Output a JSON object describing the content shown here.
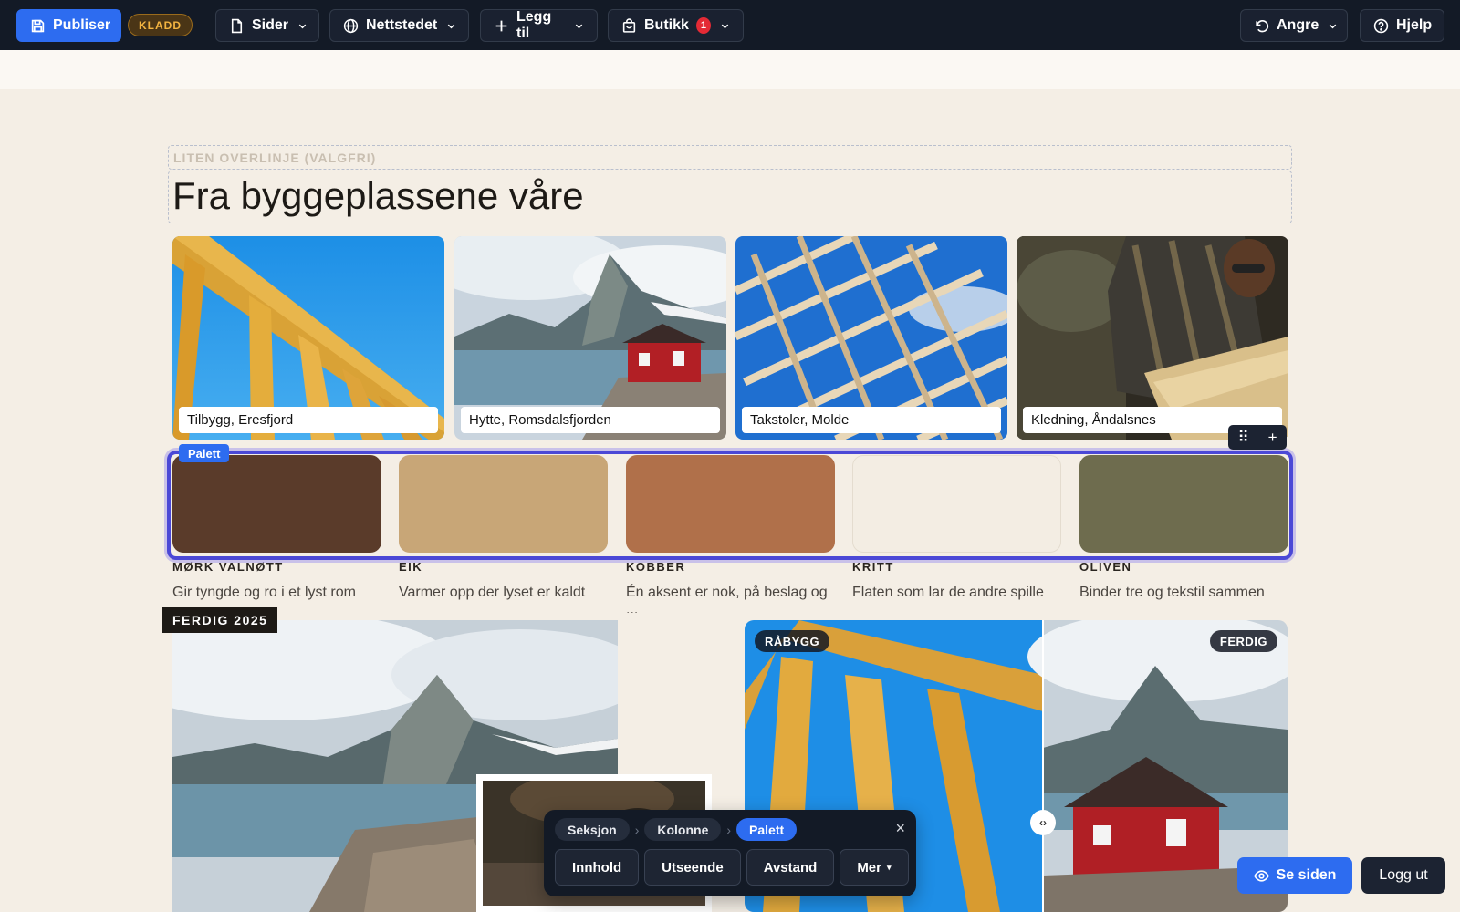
{
  "toolbar": {
    "publish_label": "Publiser",
    "draft_badge": "KLADD",
    "pages_label": "Sider",
    "website_label": "Nettstedet",
    "add_label": "Legg til",
    "shop_label": "Butikk",
    "shop_count": "1",
    "undo_label": "Angre",
    "help_label": "Hjelp"
  },
  "header": {
    "overline_placeholder": "LITEN OVERLINJE (VALGFRI)",
    "title": "Fra byggeplassene våre"
  },
  "photos": [
    {
      "caption": "Tilbygg, Eresfjord"
    },
    {
      "caption": "Hytte, Romsdalsfjorden"
    },
    {
      "caption": "Takstoler, Molde"
    },
    {
      "caption": "Kledning, Åndalsnes"
    }
  ],
  "palette": {
    "tag": "Palett",
    "swatches": [
      {
        "name": "MØRK VALNØTT",
        "desc": "Gir tyngde og ro i et lyst rom",
        "color": "#5a3b2a"
      },
      {
        "name": "EIK",
        "desc": "Varmer opp der lyset er kaldt",
        "color": "#c8a677"
      },
      {
        "name": "KOBBER",
        "desc": "Én aksent er nok, på beslag og ...",
        "color": "#b0704a"
      },
      {
        "name": "KRITT",
        "desc": "Flaten som lar de andre spille",
        "color": "#f3ede3"
      },
      {
        "name": "OLIVEN",
        "desc": "Binder tre og tekstil sammen",
        "color": "#6e6c4e"
      }
    ]
  },
  "lower": {
    "done_tag": "FERDIG 2025",
    "compare_before": "RÅBYGG",
    "compare_after": "FERDIG",
    "compare_handle": "‹›"
  },
  "editor": {
    "crumbs": [
      "Seksjon",
      "Kolonne",
      "Palett"
    ],
    "close": "×",
    "buttons": [
      "Innhold",
      "Utseende",
      "Avstand",
      "Mer"
    ],
    "more_caret": "▾"
  },
  "footer": {
    "view_site_label": "Se siden",
    "logout_label": "Logg ut"
  },
  "colors": {
    "accent": "#2d6cf0",
    "toolbar_bg": "#131a26",
    "selection": "#4b48d6",
    "page_bg": "#f4eee5"
  }
}
